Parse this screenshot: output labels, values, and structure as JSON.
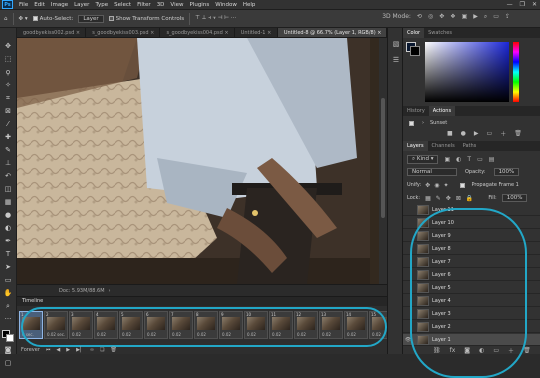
{
  "menu": [
    "File",
    "Edit",
    "Image",
    "Layer",
    "Type",
    "Select",
    "Filter",
    "3D",
    "View",
    "Plugins",
    "Window",
    "Help"
  ],
  "app_logo": "Ps",
  "window_controls": [
    "—",
    "❐",
    "✕"
  ],
  "options": {
    "auto_select": "Auto-Select:",
    "layer_dropdown": "Layer",
    "transform": "Show Transform Controls",
    "mode_3d": "3D Mode:"
  },
  "tabs": [
    "goodbyekiss002.psd",
    "s_goodbyekiss003.psd",
    "s_goodbyekiss004.psd",
    "Untitled-1",
    "Untitled-8 @ 66.7% (Layer 1, RGB/8)"
  ],
  "tab_close": "×",
  "status": {
    "doc": "Doc: 5.93M/88.6M",
    "arrow": "›"
  },
  "timeline": {
    "title": "Timeline",
    "frames": [
      {
        "n": "1",
        "t": "0 sec."
      },
      {
        "n": "2",
        "t": "0.02 sec."
      },
      {
        "n": "3",
        "t": "0.02"
      },
      {
        "n": "4",
        "t": "0.02"
      },
      {
        "n": "5",
        "t": "0.02"
      },
      {
        "n": "6",
        "t": "0.02"
      },
      {
        "n": "7",
        "t": "0.02"
      },
      {
        "n": "8",
        "t": "0.02"
      },
      {
        "n": "9",
        "t": "0.02"
      },
      {
        "n": "10",
        "t": "0.02"
      },
      {
        "n": "11",
        "t": "0.02"
      },
      {
        "n": "12",
        "t": "0.02"
      },
      {
        "n": "13",
        "t": "0.02"
      },
      {
        "n": "14",
        "t": "0.02"
      },
      {
        "n": "15",
        "t": "0.02"
      }
    ],
    "loop": "Forever"
  },
  "panels": {
    "color_tabs": [
      "Color",
      "Swatches"
    ],
    "history_tabs": [
      "History",
      "Actions"
    ],
    "action_set": "Sunset",
    "layer_tabs": [
      "Layers",
      "Channels",
      "Paths"
    ],
    "kind": "Kind",
    "blend": "Normal",
    "opacity_label": "Opacity:",
    "opacity_value": "100%",
    "unify": "Unify:",
    "propagate": "Propagate Frame 1",
    "lock": "Lock:",
    "fill_label": "Fill:",
    "fill_value": "100%"
  },
  "layers": [
    "Layer 11",
    "Layer 10",
    "Layer 9",
    "Layer 8",
    "Layer 7",
    "Layer 6",
    "Layer 5",
    "Layer 4",
    "Layer 3",
    "Layer 2",
    "Layer 1"
  ],
  "colors": {
    "accent": "#22a7c7",
    "fg_swatch": "#0a1830"
  }
}
